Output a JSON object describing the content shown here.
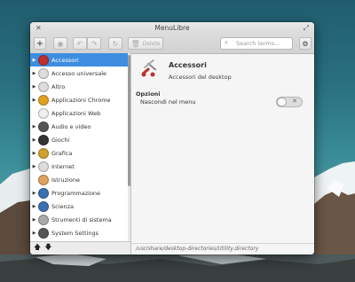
{
  "window": {
    "title": "MenuLibre"
  },
  "toolbar": {
    "add_icon": "+",
    "save_icon": "save-icon",
    "undo_icon": "undo-icon",
    "redo_icon": "redo-icon",
    "revert_icon": "revert-icon",
    "delete_label": "Delete",
    "search_placeholder": "Search terms...",
    "settings_icon": "gear-icon"
  },
  "sidebar": {
    "items": [
      {
        "label": "Accessori",
        "selected": true,
        "expandable": true,
        "icon": "accessories-icon",
        "color": "#c03030"
      },
      {
        "label": "Accesso universale",
        "selected": false,
        "expandable": true,
        "icon": "accessibility-icon",
        "color": "#dddddd"
      },
      {
        "label": "Altro",
        "selected": false,
        "expandable": true,
        "icon": "other-icon",
        "color": "#dddddd"
      },
      {
        "label": "Applicazioni Chrome",
        "selected": false,
        "expandable": true,
        "icon": "chrome-icon",
        "color": "#e0a020"
      },
      {
        "label": "Applicazioni Web",
        "selected": false,
        "expandable": false,
        "icon": "web-apps-icon",
        "color": "#eeeeee"
      },
      {
        "label": "Audio e video",
        "selected": false,
        "expandable": true,
        "icon": "multimedia-icon",
        "color": "#555555"
      },
      {
        "label": "Giochi",
        "selected": false,
        "expandable": true,
        "icon": "games-icon",
        "color": "#333333"
      },
      {
        "label": "Grafica",
        "selected": false,
        "expandable": true,
        "icon": "graphics-icon",
        "color": "#d0a030"
      },
      {
        "label": "Internet",
        "selected": false,
        "expandable": true,
        "icon": "internet-icon",
        "color": "#dddddd"
      },
      {
        "label": "Istruzione",
        "selected": false,
        "expandable": false,
        "icon": "education-icon",
        "color": "#e0a060"
      },
      {
        "label": "Programmazione",
        "selected": false,
        "expandable": true,
        "icon": "development-icon",
        "color": "#3a70b0"
      },
      {
        "label": "Scienza",
        "selected": false,
        "expandable": true,
        "icon": "science-icon",
        "color": "#3a70b0"
      },
      {
        "label": "Strumenti di sistema",
        "selected": false,
        "expandable": true,
        "icon": "system-tools-icon",
        "color": "#aaaaaa"
      },
      {
        "label": "System Settings",
        "selected": false,
        "expandable": true,
        "icon": "system-settings-icon",
        "color": "#555555"
      }
    ],
    "move_up_icon": "arrow-up-icon",
    "move_down_icon": "arrow-down-icon"
  },
  "details": {
    "name": "Accessori",
    "comment": "Accessori del desktop",
    "options_title": "Opzioni",
    "hide_label": "Nascondi nel menu",
    "hide_value": false,
    "path": "/usr/share/desktop-directories/Utility.directory"
  },
  "colors": {
    "selection": "#3d8ee0",
    "window_bg": "#f5f5f5"
  }
}
